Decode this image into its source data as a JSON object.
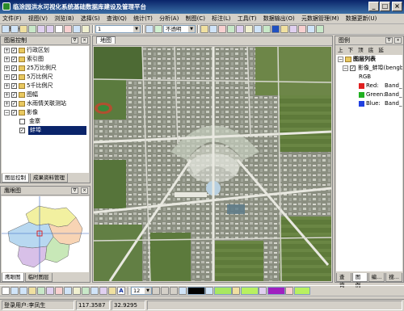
{
  "window": {
    "title": "临涂园洪水可视化系统基础数据库建设及管理平台",
    "controls": [
      "_",
      "□",
      "×"
    ]
  },
  "menu": [
    "文件(F)",
    "视图(V)",
    "浏览(B)",
    "选择(S)",
    "查询(Q)",
    "统计(T)",
    "分析(A)",
    "制图(C)",
    "标注(L)",
    "工具(T)",
    "数据输出(O)",
    "元数据管理(M)",
    "数据更新(U)",
    "帮助(H)"
  ],
  "toolbar1": {
    "scale_value": "1",
    "opacity_value": "不透明"
  },
  "toolbar2": {
    "font_size": "12"
  },
  "layer_panel": {
    "title": "图层控制",
    "items": [
      {
        "label": "行政区划",
        "checked": true
      },
      {
        "label": "索引图",
        "checked": true
      },
      {
        "label": "25万比例尺",
        "checked": true
      },
      {
        "label": "5万比例尺",
        "checked": true
      },
      {
        "label": "5千比例尺",
        "checked": true
      },
      {
        "label": "图幅",
        "checked": true
      },
      {
        "label": "水雨情关联测站",
        "checked": true
      },
      {
        "label": "影像",
        "checked": true
      },
      {
        "label": "金寨",
        "checked": false
      },
      {
        "label": "蚌埠",
        "checked": true
      }
    ],
    "tabs": [
      "图层控制",
      "成果资料管理"
    ]
  },
  "eagle_panel": {
    "title": "鹰眼图",
    "tabs": [
      "鹰眼图",
      "临时图层"
    ]
  },
  "map_panel": {
    "tab": "地图"
  },
  "legend_panel": {
    "title": "图例",
    "nav": [
      "上",
      "下",
      "顶",
      "底",
      "延"
    ],
    "list_title": "图层列表",
    "layer_name": "影像_蚌埠(bengb",
    "mode": "RGB",
    "bands": [
      {
        "label": "Red:",
        "value": "Band_1",
        "color": "#e02020"
      },
      {
        "label": "Green:",
        "value": "Band_2",
        "color": "#20b020"
      },
      {
        "label": "Blue:",
        "value": "Band_3",
        "color": "#2040e0"
      }
    ],
    "tabs": [
      "查询",
      "图例",
      "编...",
      "搜..."
    ]
  },
  "status": {
    "user": "登录用户:李凤生",
    "x": "117.3587",
    "y": "32.9295"
  }
}
